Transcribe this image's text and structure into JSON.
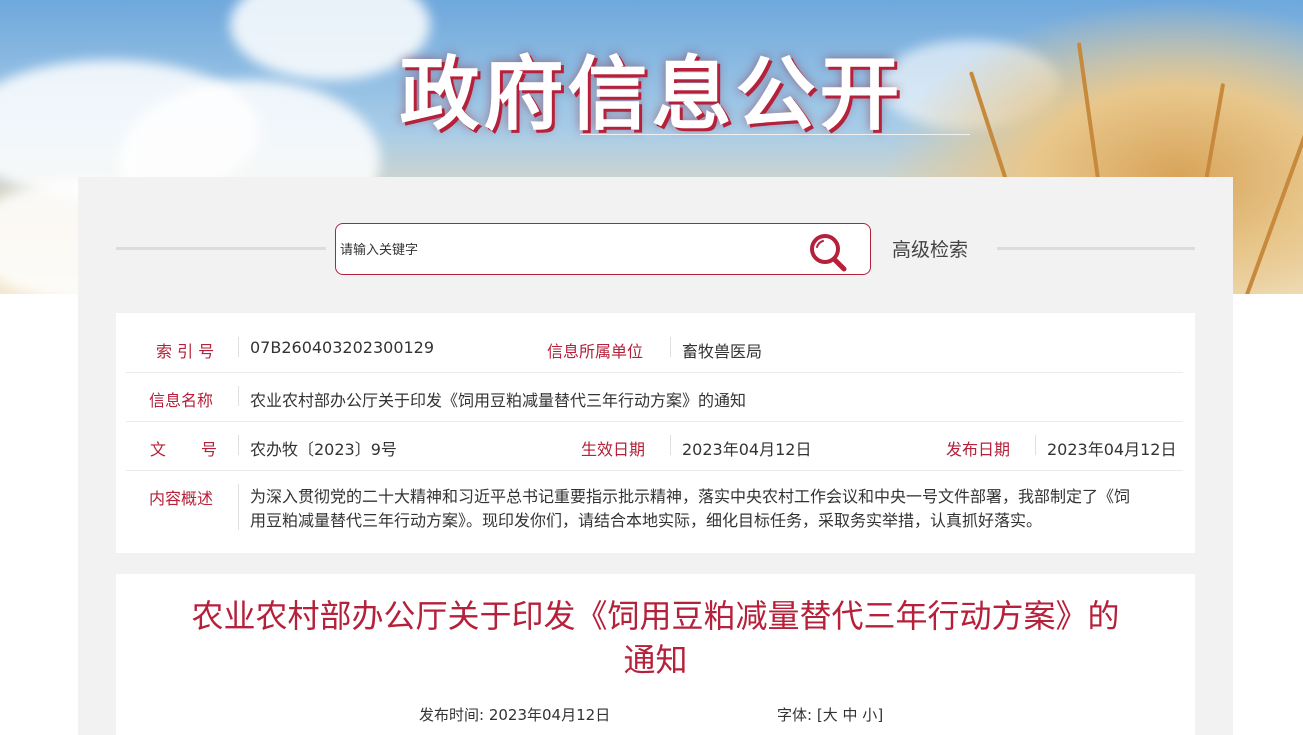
{
  "banner": {
    "title": "政府信息公开"
  },
  "search": {
    "placeholder": "请输入关键字",
    "advanced_label": "高级检索"
  },
  "meta": {
    "index_label": "索 引 号",
    "index_value": "07B260403202300129",
    "unit_label": "信息所属单位",
    "unit_value": "畜牧兽医局",
    "name_label": "信息名称",
    "name_value": "农业农村部办公厅关于印发《饲用豆粕减量替代三年行动方案》的通知",
    "docno_label_1": "文",
    "docno_label_2": "号",
    "docno_value": "农办牧〔2023〕9号",
    "effective_label": "生效日期",
    "effective_value": "2023年04月12日",
    "publish_label": "发布日期",
    "publish_value": "2023年04月12日",
    "summary_label": "内容概述",
    "summary_line1": "为深入贯彻党的二十大精神和习近平总书记重要指示批示精神，落实中央农村工作会议和中央一号文件部署，我部制定了《饲",
    "summary_line2": "用豆粕减量替代三年行动方案》。现印发你们，请结合本地实际，细化目标任务，采取务实举措，认真抓好落实。"
  },
  "article": {
    "title_line1": "农业农村部办公厅关于印发《饲用豆粕减量替代三年行动方案》的",
    "title_line2": "通知",
    "pubtime_label": "发布时间:",
    "pubtime_value": "2023年04月12日",
    "fontsize_label": "字体:",
    "bracket_open": "[",
    "size_large": "大",
    "size_medium": "中",
    "size_small": "小",
    "bracket_close": "]"
  },
  "colors": {
    "accent": "#b5203a",
    "panel_bg": "#f2f2f2"
  }
}
